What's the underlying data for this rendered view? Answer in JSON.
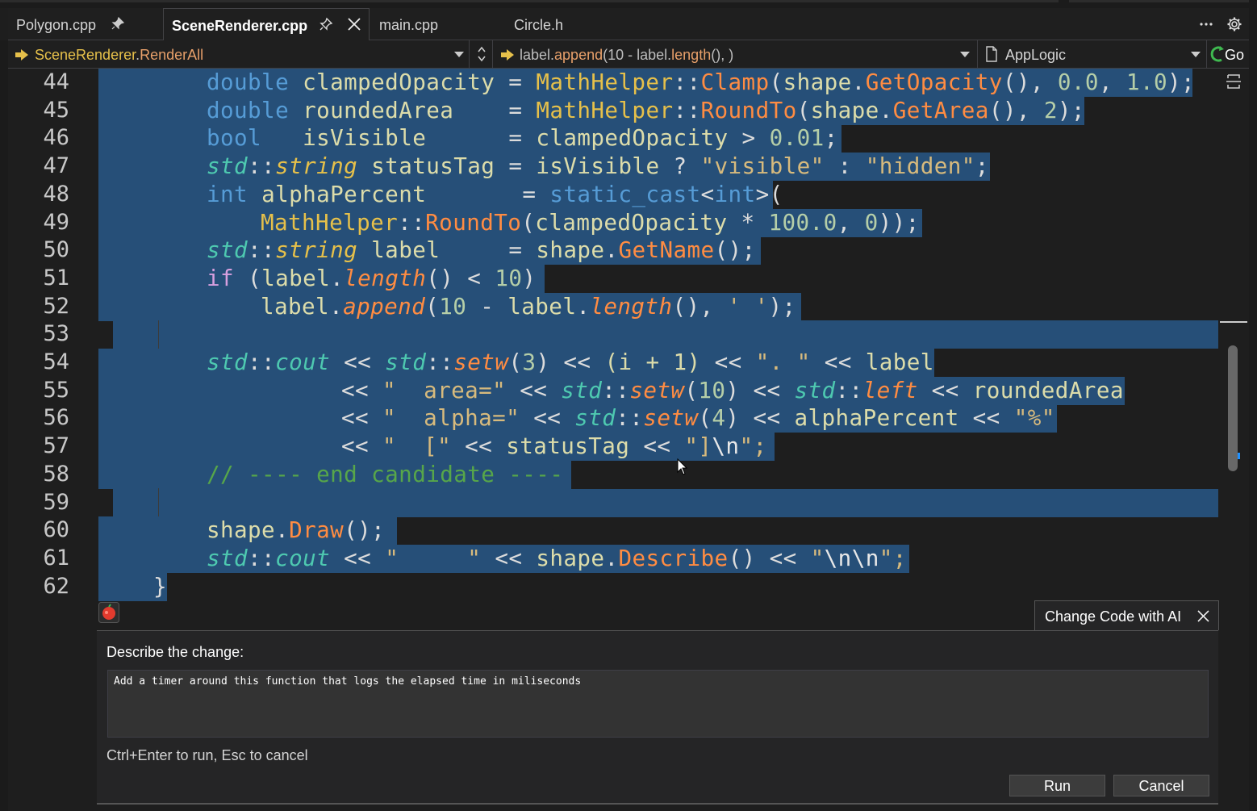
{
  "tabs": [
    {
      "label": "Polygon.cpp",
      "active": false,
      "pinned": true
    },
    {
      "label": "SceneRenderer.cpp",
      "active": true,
      "pinned": true
    },
    {
      "label": "main.cpp",
      "active": false,
      "pinned": false
    },
    {
      "label": "Circle.h",
      "active": false,
      "pinned": false
    }
  ],
  "navbar": {
    "scope_class": "SceneRenderer",
    "scope_sep": ".",
    "scope_member": "RenderAll",
    "member_prefix": "label.",
    "member_call": "append",
    "member_mid": "(10 - label.",
    "member_call2": "length",
    "member_suffix": "(), )",
    "project": "AppLogic",
    "go_label": "Go"
  },
  "line_numbers": [
    "44",
    "45",
    "46",
    "47",
    "48",
    "49",
    "50",
    "51",
    "52",
    "53",
    "54",
    "55",
    "56",
    "57",
    "58",
    "59",
    "60",
    "61",
    "62"
  ],
  "code": {
    "l44": [
      "double",
      "clampedOpacity",
      "=",
      "MathHelper",
      "::",
      "Clamp",
      "(",
      "shape",
      ".",
      "GetOpacity",
      "(),",
      "0.0",
      ",",
      "1.0",
      ");"
    ],
    "l45": [
      "double",
      "roundedArea",
      "=",
      "MathHelper",
      "::",
      "RoundTo",
      "(",
      "shape",
      ".",
      "GetArea",
      "(),",
      "2",
      ");"
    ],
    "l46": [
      "bool",
      "isVisible",
      "=",
      "clampedOpacity",
      ">",
      "0.01",
      ";"
    ],
    "l47": [
      "std",
      "::",
      "string",
      "statusTag",
      "=",
      "isVisible",
      "?",
      "\"visible\"",
      ":",
      "\"hidden\"",
      ";"
    ],
    "l48": [
      "int",
      "alphaPercent",
      "=",
      "static_cast",
      "<",
      "int",
      ">("
    ],
    "l49": [
      "MathHelper",
      "::",
      "RoundTo",
      "(",
      "clampedOpacity",
      "*",
      "100.0",
      ",",
      "0",
      "));"
    ],
    "l50": [
      "std",
      "::",
      "string",
      "label",
      "=",
      "shape",
      ".",
      "GetName",
      "();"
    ],
    "l51": [
      "if",
      "(",
      "label",
      ".",
      "length",
      "()",
      "<",
      "10",
      ")"
    ],
    "l52": [
      "label",
      ".",
      "append",
      "(",
      "10",
      "-",
      "label",
      ".",
      "length",
      "(),",
      "' '",
      ");"
    ],
    "l54": [
      "std",
      "::",
      "cout",
      "<<",
      "std",
      "::",
      "setw",
      "(",
      "3",
      ")",
      "<<",
      "(i + 1)",
      "<<",
      "\". \"",
      "<<",
      "label"
    ],
    "l55": [
      "<<",
      "\"  area=\"",
      "<<",
      "std",
      "::",
      "setw",
      "(",
      "10",
      ")",
      "<<",
      "std",
      "::",
      "left",
      "<<",
      "roundedArea"
    ],
    "l56": [
      "<<",
      "\"  alpha=\"",
      "<<",
      "std",
      "::",
      "setw",
      "(",
      "4",
      ")",
      "<<",
      "alphaPercent",
      "<<",
      "\"%\""
    ],
    "l57": [
      "<<",
      "\"  [\"",
      "<<",
      "statusTag",
      "<<",
      "\"]",
      "\\n",
      "\";"
    ],
    "l58": [
      "// ---- end candidate ----"
    ],
    "l60": [
      "shape",
      ".",
      "Draw",
      "();"
    ],
    "l61": [
      "std",
      "::",
      "cout",
      "<<",
      "\"     \"",
      "<<",
      "shape",
      ".",
      "Describe",
      "()",
      "<<",
      "\"",
      "\\n\\n",
      "\";"
    ],
    "l62": [
      "}"
    ]
  },
  "ai_panel": {
    "badge_label": "Change Code with AI",
    "prompt_label": "Describe the change:",
    "prompt_value": "Add a timer around this function that logs the elapsed time in miliseconds",
    "hint": "Ctrl+Enter to run, Esc to cancel",
    "run_label": "Run",
    "cancel_label": "Cancel"
  },
  "colors": {
    "selection": "#264f78",
    "keyword": "#569cd6",
    "type_ns": "#4ec9b0",
    "class_name": "#e6c04a",
    "function": "#ff8c42",
    "string": "#d7ba7d",
    "number": "#b5cea8",
    "comment": "#57a64a"
  },
  "icons": {
    "tab_pin": "pin-icon",
    "tab_close": "close-icon",
    "more": "more-icon",
    "settings": "gear-icon",
    "scope": "scope-icon",
    "document": "document-icon",
    "go": "go-icon",
    "split": "split-editor-icon",
    "ai_close": "close-icon",
    "copilot": "copilot-icon"
  }
}
